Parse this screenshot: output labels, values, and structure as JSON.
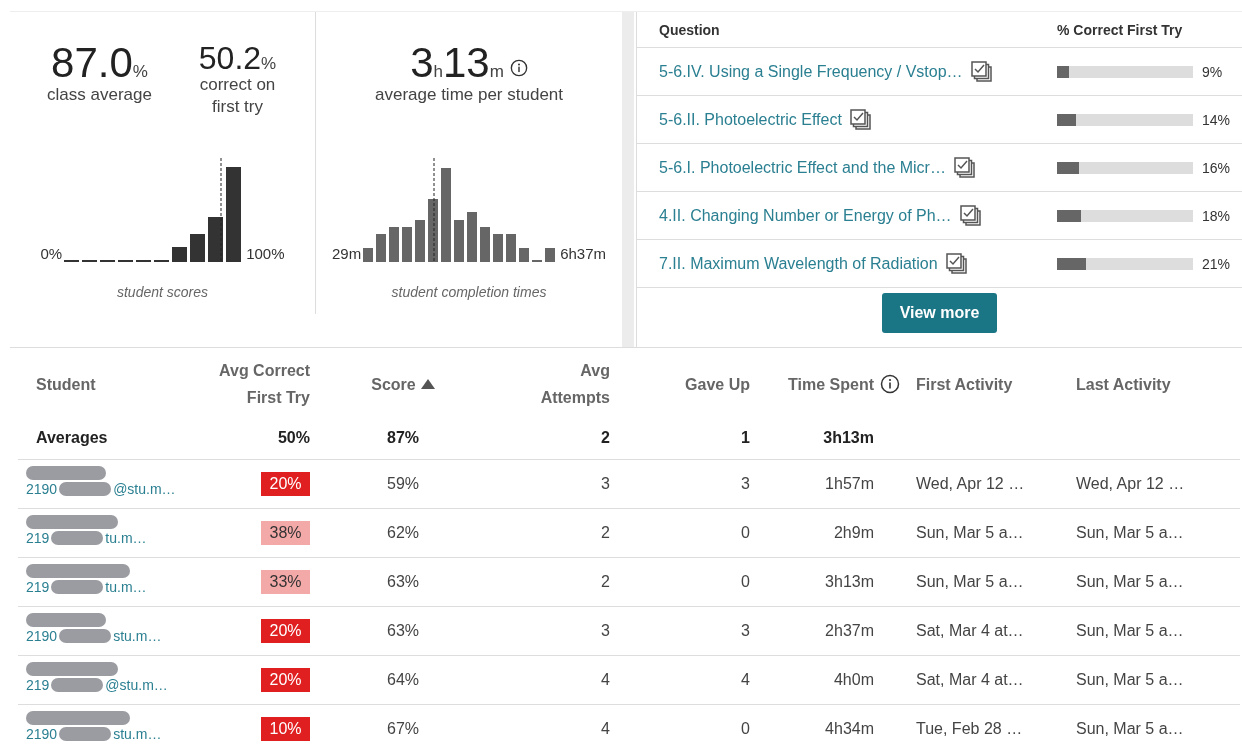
{
  "summary": {
    "stats": [
      {
        "value": "87.0",
        "unit": "%",
        "label": "class average"
      },
      {
        "value": "50.2",
        "unit": "%",
        "label": "correct on first try"
      }
    ],
    "scores_chart": {
      "min_label": "0%",
      "max_label": "100%",
      "caption": "student scores"
    },
    "time_stat": {
      "hours": "3",
      "hours_unit": "h",
      "minutes": "13",
      "minutes_unit": "m",
      "label": "average time per student"
    },
    "times_chart": {
      "min_label": "29m",
      "max_label": "6h37m",
      "caption": "student completion times"
    }
  },
  "questions": {
    "columns": [
      "Question",
      "% Correct First Try"
    ],
    "rows": [
      {
        "title": "5-6.IV. Using a Single Frequency / Vstop…",
        "level": 0.09,
        "percent": "9%"
      },
      {
        "title": "5-6.II. Photoelectric Effect",
        "level": 0.14,
        "percent": "14%"
      },
      {
        "title": "5-6.I. Photoelectric Effect and the Micr…",
        "level": 0.16,
        "percent": "16%"
      },
      {
        "title": "4.II. Changing Number or Energy of Ph…",
        "level": 0.18,
        "percent": "18%"
      },
      {
        "title": "7.II. Maximum Wavelength of Radiation",
        "level": 0.21,
        "percent": "21%"
      }
    ],
    "view_more": "View more"
  },
  "students": {
    "columns": [
      {
        "label": "Student"
      },
      {
        "label": "Avg Correct First Try"
      },
      {
        "label": "Score",
        "sorted": true,
        "ascending": true
      },
      {
        "label": "Avg Attempts"
      },
      {
        "label": "Gave Up"
      },
      {
        "label": "Time Spent",
        "info": true
      },
      {
        "label": "First Activity"
      },
      {
        "label": "Last Activity"
      }
    ],
    "averages": {
      "label": "Averages",
      "correct": "50%",
      "score": "87%",
      "attempts": "2",
      "gave_up": "1",
      "time": "3h13m"
    },
    "rows": [
      {
        "email_start": "2190",
        "email_end": "@stu.m…",
        "correct": "20%",
        "color": "#e02020",
        "score": "59%",
        "attempts": "3",
        "gave_up": "3",
        "time": "1h57m",
        "first": "Wed, Apr 12 …",
        "last": "Wed, Apr 12 …"
      },
      {
        "email_start": "219",
        "email_end": "tu.m…",
        "correct": "38%",
        "color": "#f4a9a9",
        "score": "62%",
        "attempts": "2",
        "gave_up": "0",
        "time": "2h9m",
        "first": "Sun, Mar 5 a…",
        "last": "Sun, Mar 5 a…"
      },
      {
        "email_start": "219",
        "email_end": "tu.m…",
        "correct": "33%",
        "color": "#f4a9a9",
        "score": "63%",
        "attempts": "2",
        "gave_up": "0",
        "time": "3h13m",
        "first": "Sun, Mar 5 a…",
        "last": "Sun, Mar 5 a…"
      },
      {
        "email_start": "2190",
        "email_end": "stu.m…",
        "correct": "20%",
        "color": "#e02020",
        "score": "63%",
        "attempts": "3",
        "gave_up": "3",
        "time": "2h37m",
        "first": "Sat, Mar 4 at…",
        "last": "Sun, Mar 5 a…"
      },
      {
        "email_start": "219",
        "email_end": "@stu.m…",
        "correct": "20%",
        "color": "#e02020",
        "score": "64%",
        "attempts": "4",
        "gave_up": "4",
        "time": "4h0m",
        "first": "Sat, Mar 4 at…",
        "last": "Sun, Mar 5 a…"
      },
      {
        "email_start": "2190",
        "email_end": "stu.m…",
        "correct": "10%",
        "color": "#e02020",
        "score": "67%",
        "attempts": "4",
        "gave_up": "0",
        "time": "4h34m",
        "first": "Tue, Feb 28 …",
        "last": "Sun, Mar 5 a…"
      }
    ]
  }
}
